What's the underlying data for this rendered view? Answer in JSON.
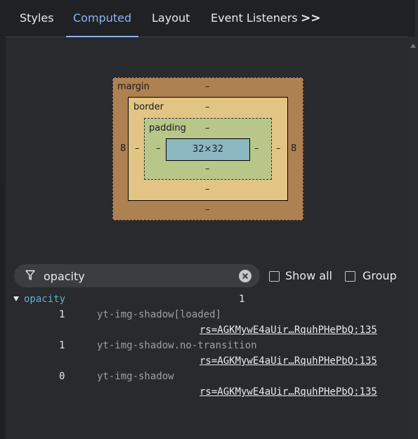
{
  "tabs": [
    {
      "label": "Styles",
      "active": false
    },
    {
      "label": "Computed",
      "active": true
    },
    {
      "label": "Layout",
      "active": false
    },
    {
      "label": "Event Listeners",
      "active": false
    }
  ],
  "tabs_more": ">>",
  "box_model": {
    "margin_label": "margin",
    "margin_top": "–",
    "margin_bottom": "–",
    "margin_left": "8",
    "margin_right": "8",
    "border_label": "border",
    "border_top": "–",
    "border_bottom": "–",
    "border_left": "–",
    "border_right": "–",
    "padding_label": "padding",
    "padding_top": "–",
    "padding_bottom": "–",
    "padding_left": "–",
    "padding_right": "–",
    "content_size": "32×32"
  },
  "filter": {
    "value": "opacity",
    "show_all_label": "Show all",
    "group_label": "Group"
  },
  "property": {
    "name": "opacity",
    "computed_value": "1",
    "traces": [
      {
        "value": "1",
        "selector": "yt-img-shadow[loaded]",
        "source": "rs=AGKMywE4aUir…RquhPHePbQ:135"
      },
      {
        "value": "1",
        "selector": "yt-img-shadow.no-transition",
        "source": "rs=AGKMywE4aUir…RquhPHePbQ:135"
      },
      {
        "value": "0",
        "selector": "yt-img-shadow",
        "source": "rs=AGKMywE4aUir…RquhPHePbQ:135"
      }
    ]
  }
}
